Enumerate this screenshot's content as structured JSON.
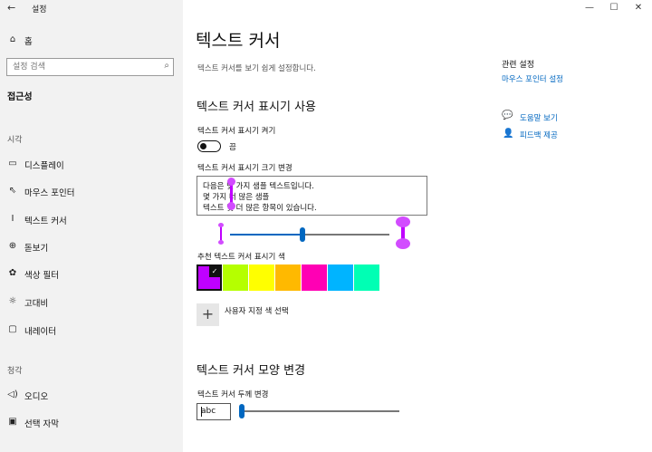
{
  "window": {
    "app_title": "설정",
    "minimize": "—",
    "maximize": "☐",
    "close": "✕"
  },
  "sidebar": {
    "home_label": "홈",
    "search_placeholder": "설정 검색",
    "current_section": "접근성",
    "group_vision": "시각",
    "items_vision": [
      {
        "label": "디스플레이",
        "icon": "display-icon"
      },
      {
        "label": "마우스 포인터",
        "icon": "mouse-pointer-icon"
      },
      {
        "label": "텍스트 커서",
        "icon": "text-cursor-icon"
      },
      {
        "label": "돋보기",
        "icon": "magnifier-icon"
      },
      {
        "label": "색상 필터",
        "icon": "color-filter-icon"
      },
      {
        "label": "고대비",
        "icon": "high-contrast-icon"
      },
      {
        "label": "내레이터",
        "icon": "narrator-icon"
      }
    ],
    "group_hearing": "청각",
    "items_hearing": [
      {
        "label": "오디오",
        "icon": "audio-icon"
      },
      {
        "label": "선택 자막",
        "icon": "closed-captions-icon"
      }
    ]
  },
  "main": {
    "title": "텍스트 커서",
    "description": "텍스트 커서를 보기 쉽게 설정합니다.",
    "indicator_heading": "텍스트 커서 표시기 사용",
    "indicator_toggle_label": "텍스트 커서 표시기 켜기",
    "indicator_toggle_state": "끔",
    "indicator_size_label": "텍스트 커서 표시기 크기 변경",
    "preview_lines": [
      "다음은 몇 가지 샘플 텍스트입니다.",
      "몇 가지 더 많은 샘플",
      "텍스트 및 더 많은 항목이 있습니다."
    ],
    "indicator_size_value": 0.45,
    "color_label": "추천 텍스트 커서 표시기 색",
    "colors": [
      "#bf00ff",
      "#b5ff00",
      "#ffff00",
      "#ffb900",
      "#ff00b4",
      "#00b4ff",
      "#00ffb4"
    ],
    "selected_color_index": 0,
    "custom_color_label": "사용자 지정 색 선택",
    "custom_color_icon": "+",
    "appearance_heading": "텍스트 커서 모양 변경",
    "thickness_label": "텍스트 커서 두께 변경",
    "thickness_preview": "abc",
    "thickness_value": 0.0
  },
  "related": {
    "title": "관련 설정",
    "mouse_pointer_link": "마우스 포인터 설정",
    "help_link": "도움말 보기",
    "feedback_link": "피드백 제공"
  }
}
